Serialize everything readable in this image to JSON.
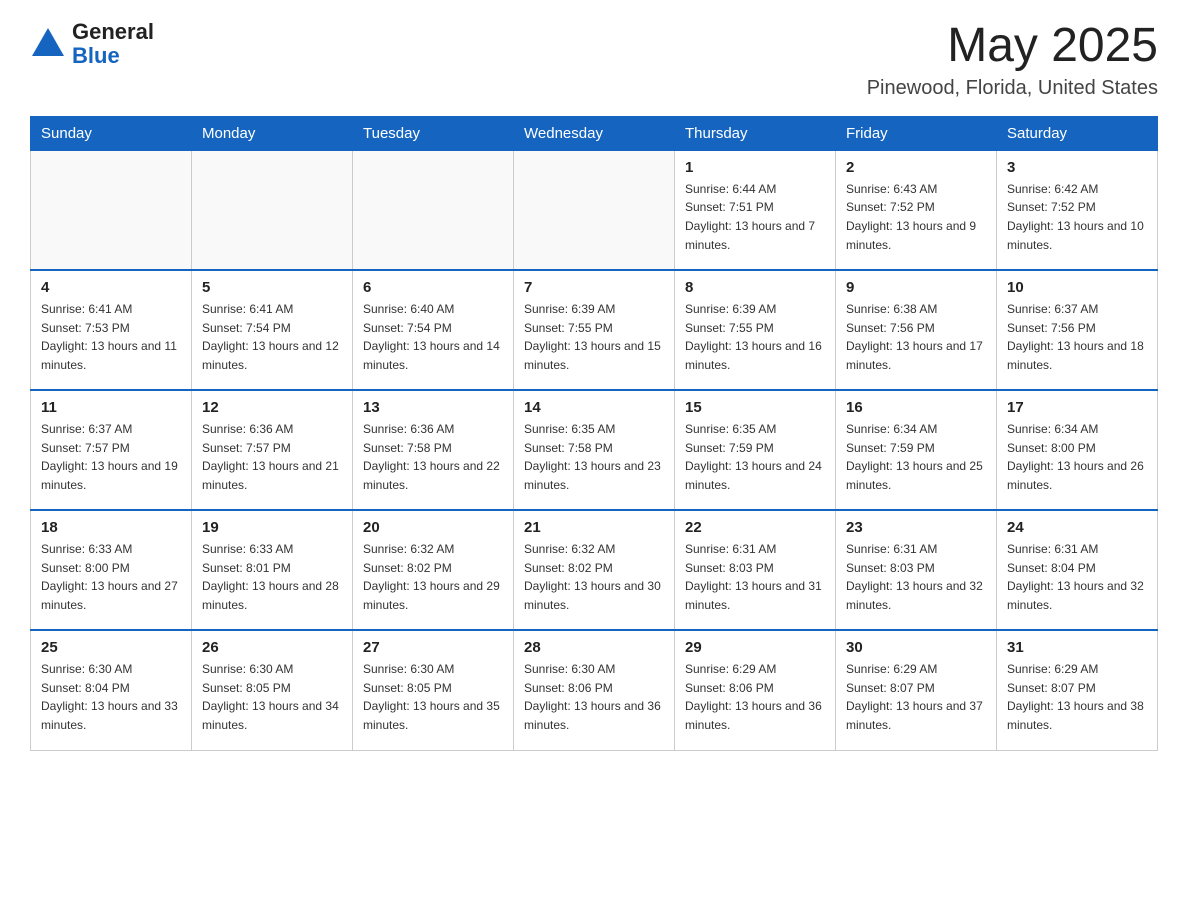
{
  "logo": {
    "text_general": "General",
    "text_blue": "Blue",
    "triangle_aria": "triangle-icon"
  },
  "header": {
    "month_year": "May 2025",
    "location": "Pinewood, Florida, United States"
  },
  "weekdays": [
    "Sunday",
    "Monday",
    "Tuesday",
    "Wednesday",
    "Thursday",
    "Friday",
    "Saturday"
  ],
  "weeks": [
    [
      {
        "day": "",
        "sunrise": "",
        "sunset": "",
        "daylight": ""
      },
      {
        "day": "",
        "sunrise": "",
        "sunset": "",
        "daylight": ""
      },
      {
        "day": "",
        "sunrise": "",
        "sunset": "",
        "daylight": ""
      },
      {
        "day": "",
        "sunrise": "",
        "sunset": "",
        "daylight": ""
      },
      {
        "day": "1",
        "sunrise": "Sunrise: 6:44 AM",
        "sunset": "Sunset: 7:51 PM",
        "daylight": "Daylight: 13 hours and 7 minutes."
      },
      {
        "day": "2",
        "sunrise": "Sunrise: 6:43 AM",
        "sunset": "Sunset: 7:52 PM",
        "daylight": "Daylight: 13 hours and 9 minutes."
      },
      {
        "day": "3",
        "sunrise": "Sunrise: 6:42 AM",
        "sunset": "Sunset: 7:52 PM",
        "daylight": "Daylight: 13 hours and 10 minutes."
      }
    ],
    [
      {
        "day": "4",
        "sunrise": "Sunrise: 6:41 AM",
        "sunset": "Sunset: 7:53 PM",
        "daylight": "Daylight: 13 hours and 11 minutes."
      },
      {
        "day": "5",
        "sunrise": "Sunrise: 6:41 AM",
        "sunset": "Sunset: 7:54 PM",
        "daylight": "Daylight: 13 hours and 12 minutes."
      },
      {
        "day": "6",
        "sunrise": "Sunrise: 6:40 AM",
        "sunset": "Sunset: 7:54 PM",
        "daylight": "Daylight: 13 hours and 14 minutes."
      },
      {
        "day": "7",
        "sunrise": "Sunrise: 6:39 AM",
        "sunset": "Sunset: 7:55 PM",
        "daylight": "Daylight: 13 hours and 15 minutes."
      },
      {
        "day": "8",
        "sunrise": "Sunrise: 6:39 AM",
        "sunset": "Sunset: 7:55 PM",
        "daylight": "Daylight: 13 hours and 16 minutes."
      },
      {
        "day": "9",
        "sunrise": "Sunrise: 6:38 AM",
        "sunset": "Sunset: 7:56 PM",
        "daylight": "Daylight: 13 hours and 17 minutes."
      },
      {
        "day": "10",
        "sunrise": "Sunrise: 6:37 AM",
        "sunset": "Sunset: 7:56 PM",
        "daylight": "Daylight: 13 hours and 18 minutes."
      }
    ],
    [
      {
        "day": "11",
        "sunrise": "Sunrise: 6:37 AM",
        "sunset": "Sunset: 7:57 PM",
        "daylight": "Daylight: 13 hours and 19 minutes."
      },
      {
        "day": "12",
        "sunrise": "Sunrise: 6:36 AM",
        "sunset": "Sunset: 7:57 PM",
        "daylight": "Daylight: 13 hours and 21 minutes."
      },
      {
        "day": "13",
        "sunrise": "Sunrise: 6:36 AM",
        "sunset": "Sunset: 7:58 PM",
        "daylight": "Daylight: 13 hours and 22 minutes."
      },
      {
        "day": "14",
        "sunrise": "Sunrise: 6:35 AM",
        "sunset": "Sunset: 7:58 PM",
        "daylight": "Daylight: 13 hours and 23 minutes."
      },
      {
        "day": "15",
        "sunrise": "Sunrise: 6:35 AM",
        "sunset": "Sunset: 7:59 PM",
        "daylight": "Daylight: 13 hours and 24 minutes."
      },
      {
        "day": "16",
        "sunrise": "Sunrise: 6:34 AM",
        "sunset": "Sunset: 7:59 PM",
        "daylight": "Daylight: 13 hours and 25 minutes."
      },
      {
        "day": "17",
        "sunrise": "Sunrise: 6:34 AM",
        "sunset": "Sunset: 8:00 PM",
        "daylight": "Daylight: 13 hours and 26 minutes."
      }
    ],
    [
      {
        "day": "18",
        "sunrise": "Sunrise: 6:33 AM",
        "sunset": "Sunset: 8:00 PM",
        "daylight": "Daylight: 13 hours and 27 minutes."
      },
      {
        "day": "19",
        "sunrise": "Sunrise: 6:33 AM",
        "sunset": "Sunset: 8:01 PM",
        "daylight": "Daylight: 13 hours and 28 minutes."
      },
      {
        "day": "20",
        "sunrise": "Sunrise: 6:32 AM",
        "sunset": "Sunset: 8:02 PM",
        "daylight": "Daylight: 13 hours and 29 minutes."
      },
      {
        "day": "21",
        "sunrise": "Sunrise: 6:32 AM",
        "sunset": "Sunset: 8:02 PM",
        "daylight": "Daylight: 13 hours and 30 minutes."
      },
      {
        "day": "22",
        "sunrise": "Sunrise: 6:31 AM",
        "sunset": "Sunset: 8:03 PM",
        "daylight": "Daylight: 13 hours and 31 minutes."
      },
      {
        "day": "23",
        "sunrise": "Sunrise: 6:31 AM",
        "sunset": "Sunset: 8:03 PM",
        "daylight": "Daylight: 13 hours and 32 minutes."
      },
      {
        "day": "24",
        "sunrise": "Sunrise: 6:31 AM",
        "sunset": "Sunset: 8:04 PM",
        "daylight": "Daylight: 13 hours and 32 minutes."
      }
    ],
    [
      {
        "day": "25",
        "sunrise": "Sunrise: 6:30 AM",
        "sunset": "Sunset: 8:04 PM",
        "daylight": "Daylight: 13 hours and 33 minutes."
      },
      {
        "day": "26",
        "sunrise": "Sunrise: 6:30 AM",
        "sunset": "Sunset: 8:05 PM",
        "daylight": "Daylight: 13 hours and 34 minutes."
      },
      {
        "day": "27",
        "sunrise": "Sunrise: 6:30 AM",
        "sunset": "Sunset: 8:05 PM",
        "daylight": "Daylight: 13 hours and 35 minutes."
      },
      {
        "day": "28",
        "sunrise": "Sunrise: 6:30 AM",
        "sunset": "Sunset: 8:06 PM",
        "daylight": "Daylight: 13 hours and 36 minutes."
      },
      {
        "day": "29",
        "sunrise": "Sunrise: 6:29 AM",
        "sunset": "Sunset: 8:06 PM",
        "daylight": "Daylight: 13 hours and 36 minutes."
      },
      {
        "day": "30",
        "sunrise": "Sunrise: 6:29 AM",
        "sunset": "Sunset: 8:07 PM",
        "daylight": "Daylight: 13 hours and 37 minutes."
      },
      {
        "day": "31",
        "sunrise": "Sunrise: 6:29 AM",
        "sunset": "Sunset: 8:07 PM",
        "daylight": "Daylight: 13 hours and 38 minutes."
      }
    ]
  ]
}
